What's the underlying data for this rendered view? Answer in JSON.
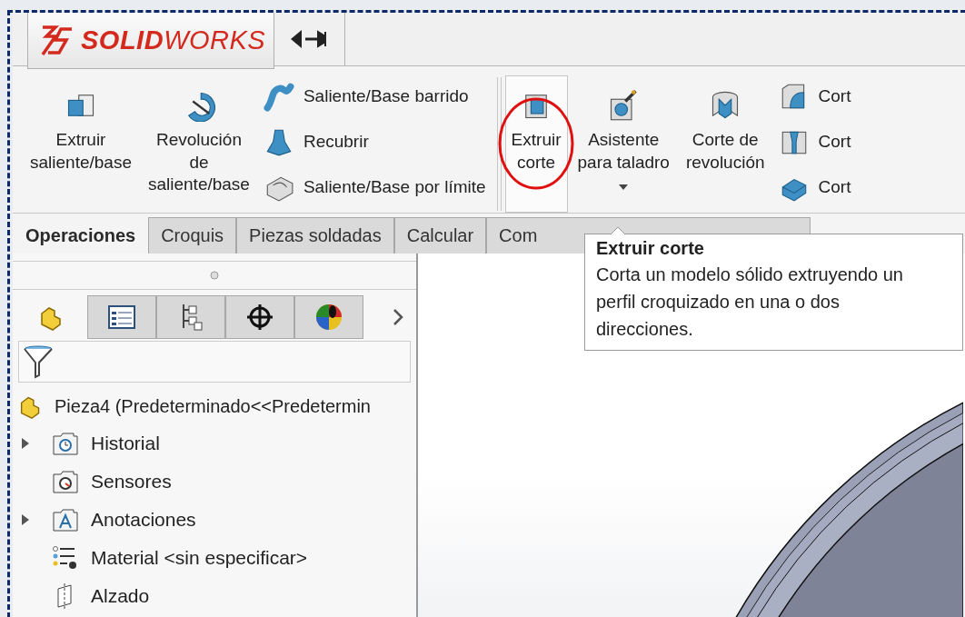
{
  "app": {
    "logo": "**SOLID**WORKS"
  },
  "ribbon": {
    "items": [
      {
        "kind": "large",
        "label": "Extruir\nsaliente/base",
        "selected": false
      },
      {
        "kind": "large",
        "label": "Revolución\nde\nsaliente/base",
        "selected": false
      },
      {
        "kind": "stack",
        "items": [
          {
            "label": "Saliente/Base barrido"
          },
          {
            "label": "Recubrir"
          },
          {
            "label": "Saliente/Base por límite"
          }
        ]
      },
      {
        "kind": "separator"
      },
      {
        "kind": "large",
        "label": "Extruir\ncorte",
        "selected": true,
        "circled": true
      },
      {
        "kind": "large",
        "label": "Asistente\npara taladro",
        "selected": false,
        "dropdown": true
      },
      {
        "kind": "large",
        "label": "Corte de\nrevolución",
        "selected": false
      },
      {
        "kind": "stack",
        "items": [
          {
            "label": "Cort"
          },
          {
            "label": "Cort"
          },
          {
            "label": "Cort"
          }
        ]
      }
    ]
  },
  "tabs": [
    {
      "label": "Operaciones",
      "selected": true
    },
    {
      "label": "Croquis",
      "selected": false
    },
    {
      "label": "Piezas soldadas",
      "selected": false
    },
    {
      "label": "Calcular",
      "selected": false
    },
    {
      "label": "Com",
      "selected": false
    }
  ],
  "tooltip": {
    "title": "Extruir corte",
    "text": "Corta un modelo sólido extruyendo un perfil croquizado en una o dos direcciones."
  },
  "panel": {
    "icon_tabs": [
      {
        "kind": "feature-tree",
        "selected": true
      },
      {
        "kind": "properties",
        "selected": false
      },
      {
        "kind": "configurations",
        "selected": false
      },
      {
        "kind": "dimxpert",
        "selected": false
      },
      {
        "kind": "display",
        "selected": false
      }
    ],
    "tree": {
      "label": "Pieza4 (Predeterminado<<Predetermin",
      "children": [
        {
          "label": "Historial",
          "kind": "history",
          "expandable": true
        },
        {
          "label": "Sensores",
          "kind": "sensors"
        },
        {
          "label": "Anotaciones",
          "kind": "annotations",
          "expandable": true
        },
        {
          "label": "Material <sin especificar>",
          "kind": "material"
        },
        {
          "label": "Alzado",
          "kind": "plane"
        }
      ]
    }
  }
}
